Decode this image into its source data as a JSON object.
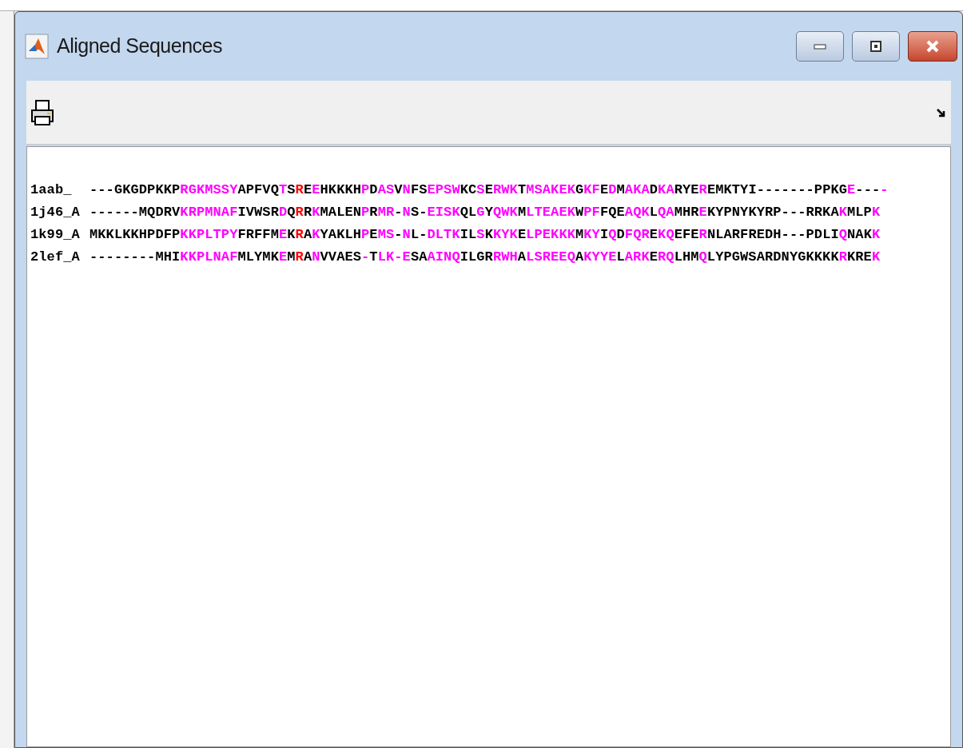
{
  "window": {
    "title": "Aligned Sequences"
  },
  "alignment": [
    {
      "name": "1aab_",
      "segments": [
        {
          "text": "---GKGDPKKP",
          "color": "#000000"
        },
        {
          "text": "RGKMSSY",
          "color": "#ff00ff"
        },
        {
          "text": "APFVQ",
          "color": "#000000"
        },
        {
          "text": "T",
          "color": "#ff00ff"
        },
        {
          "text": "S",
          "color": "#000000"
        },
        {
          "text": "R",
          "color": "#ff0000"
        },
        {
          "text": "E",
          "color": "#000000"
        },
        {
          "text": "E",
          "color": "#ff00ff"
        },
        {
          "text": "HKKKH",
          "color": "#000000"
        },
        {
          "text": "P",
          "color": "#ff00ff"
        },
        {
          "text": "D",
          "color": "#000000"
        },
        {
          "text": "AS",
          "color": "#ff00ff"
        },
        {
          "text": "V",
          "color": "#000000"
        },
        {
          "text": "N",
          "color": "#ff00ff"
        },
        {
          "text": "FS",
          "color": "#000000"
        },
        {
          "text": "EPSW",
          "color": "#ff00ff"
        },
        {
          "text": "KC",
          "color": "#000000"
        },
        {
          "text": "S",
          "color": "#ff00ff"
        },
        {
          "text": "E",
          "color": "#000000"
        },
        {
          "text": "RWK",
          "color": "#ff00ff"
        },
        {
          "text": "T",
          "color": "#000000"
        },
        {
          "text": "MSAKEK",
          "color": "#ff00ff"
        },
        {
          "text": "G",
          "color": "#000000"
        },
        {
          "text": "KF",
          "color": "#ff00ff"
        },
        {
          "text": "E",
          "color": "#000000"
        },
        {
          "text": "D",
          "color": "#ff00ff"
        },
        {
          "text": "M",
          "color": "#000000"
        },
        {
          "text": "AKA",
          "color": "#ff00ff"
        },
        {
          "text": "D",
          "color": "#000000"
        },
        {
          "text": "KA",
          "color": "#ff00ff"
        },
        {
          "text": "RYE",
          "color": "#000000"
        },
        {
          "text": "R",
          "color": "#ff00ff"
        },
        {
          "text": "EMKTYI-------PPKG",
          "color": "#000000"
        },
        {
          "text": "E",
          "color": "#ff00ff"
        },
        {
          "text": "---",
          "color": "#000000"
        },
        {
          "text": "-",
          "color": "#ff00ff"
        }
      ]
    },
    {
      "name": "1j46_A",
      "segments": [
        {
          "text": "------MQDRV",
          "color": "#000000"
        },
        {
          "text": "KRPMNAF",
          "color": "#ff00ff"
        },
        {
          "text": "IVWSR",
          "color": "#000000"
        },
        {
          "text": "D",
          "color": "#ff00ff"
        },
        {
          "text": "Q",
          "color": "#000000"
        },
        {
          "text": "R",
          "color": "#ff0000"
        },
        {
          "text": "R",
          "color": "#000000"
        },
        {
          "text": "K",
          "color": "#ff00ff"
        },
        {
          "text": "MALEN",
          "color": "#000000"
        },
        {
          "text": "P",
          "color": "#ff00ff"
        },
        {
          "text": "R",
          "color": "#000000"
        },
        {
          "text": "MR",
          "color": "#ff00ff"
        },
        {
          "text": "-",
          "color": "#000000"
        },
        {
          "text": "N",
          "color": "#ff00ff"
        },
        {
          "text": "S-",
          "color": "#000000"
        },
        {
          "text": "EISK",
          "color": "#ff00ff"
        },
        {
          "text": "QL",
          "color": "#000000"
        },
        {
          "text": "G",
          "color": "#ff00ff"
        },
        {
          "text": "Y",
          "color": "#000000"
        },
        {
          "text": "QWK",
          "color": "#ff00ff"
        },
        {
          "text": "M",
          "color": "#000000"
        },
        {
          "text": "LTEAEK",
          "color": "#ff00ff"
        },
        {
          "text": "W",
          "color": "#000000"
        },
        {
          "text": "PF",
          "color": "#ff00ff"
        },
        {
          "text": "FQE",
          "color": "#000000"
        },
        {
          "text": "AQK",
          "color": "#ff00ff"
        },
        {
          "text": "L",
          "color": "#000000"
        },
        {
          "text": "QA",
          "color": "#ff00ff"
        },
        {
          "text": "MHR",
          "color": "#000000"
        },
        {
          "text": "E",
          "color": "#ff00ff"
        },
        {
          "text": "KYPNYKYRP---RRKA",
          "color": "#000000"
        },
        {
          "text": "K",
          "color": "#ff00ff"
        },
        {
          "text": "MLP",
          "color": "#000000"
        },
        {
          "text": "K",
          "color": "#ff00ff"
        }
      ]
    },
    {
      "name": "1k99_A",
      "segments": [
        {
          "text": "MKKLKKHPDFP",
          "color": "#000000"
        },
        {
          "text": "KKPLTPY",
          "color": "#ff00ff"
        },
        {
          "text": "FRFFM",
          "color": "#000000"
        },
        {
          "text": "E",
          "color": "#ff00ff"
        },
        {
          "text": "K",
          "color": "#000000"
        },
        {
          "text": "R",
          "color": "#ff0000"
        },
        {
          "text": "A",
          "color": "#000000"
        },
        {
          "text": "K",
          "color": "#ff00ff"
        },
        {
          "text": "YAKLH",
          "color": "#000000"
        },
        {
          "text": "P",
          "color": "#ff00ff"
        },
        {
          "text": "E",
          "color": "#000000"
        },
        {
          "text": "MS",
          "color": "#ff00ff"
        },
        {
          "text": "-",
          "color": "#000000"
        },
        {
          "text": "N",
          "color": "#ff00ff"
        },
        {
          "text": "L-",
          "color": "#000000"
        },
        {
          "text": "DLTK",
          "color": "#ff00ff"
        },
        {
          "text": "IL",
          "color": "#000000"
        },
        {
          "text": "S",
          "color": "#ff00ff"
        },
        {
          "text": "K",
          "color": "#000000"
        },
        {
          "text": "KYK",
          "color": "#ff00ff"
        },
        {
          "text": "E",
          "color": "#000000"
        },
        {
          "text": "LPEKKK",
          "color": "#ff00ff"
        },
        {
          "text": "M",
          "color": "#000000"
        },
        {
          "text": "KY",
          "color": "#ff00ff"
        },
        {
          "text": "I",
          "color": "#000000"
        },
        {
          "text": "Q",
          "color": "#ff00ff"
        },
        {
          "text": "D",
          "color": "#000000"
        },
        {
          "text": "FQR",
          "color": "#ff00ff"
        },
        {
          "text": "E",
          "color": "#000000"
        },
        {
          "text": "KQ",
          "color": "#ff00ff"
        },
        {
          "text": "EFE",
          "color": "#000000"
        },
        {
          "text": "R",
          "color": "#ff00ff"
        },
        {
          "text": "NLARFREDH---PDLI",
          "color": "#000000"
        },
        {
          "text": "Q",
          "color": "#ff00ff"
        },
        {
          "text": "NAK",
          "color": "#000000"
        },
        {
          "text": "K",
          "color": "#ff00ff"
        }
      ]
    },
    {
      "name": "2lef_A",
      "segments": [
        {
          "text": "--------MHI",
          "color": "#000000"
        },
        {
          "text": "KKPLNAF",
          "color": "#ff00ff"
        },
        {
          "text": "MLYMK",
          "color": "#000000"
        },
        {
          "text": "E",
          "color": "#ff00ff"
        },
        {
          "text": "M",
          "color": "#000000"
        },
        {
          "text": "R",
          "color": "#ff0000"
        },
        {
          "text": "A",
          "color": "#000000"
        },
        {
          "text": "N",
          "color": "#ff00ff"
        },
        {
          "text": "VVAES",
          "color": "#000000"
        },
        {
          "text": "-",
          "color": "#ff00ff"
        },
        {
          "text": "T",
          "color": "#000000"
        },
        {
          "text": "LK-",
          "color": "#ff00ff"
        },
        {
          "text": "E",
          "color": "#ff00ff"
        },
        {
          "text": "SA",
          "color": "#000000"
        },
        {
          "text": "AINQ",
          "color": "#ff00ff"
        },
        {
          "text": "ILGR",
          "color": "#000000"
        },
        {
          "text": "RWH",
          "color": "#ff00ff"
        },
        {
          "text": "A",
          "color": "#000000"
        },
        {
          "text": "LSREEQ",
          "color": "#ff00ff"
        },
        {
          "text": "A",
          "color": "#000000"
        },
        {
          "text": "KYYE",
          "color": "#ff00ff"
        },
        {
          "text": "L",
          "color": "#000000"
        },
        {
          "text": "ARK",
          "color": "#ff00ff"
        },
        {
          "text": "E",
          "color": "#000000"
        },
        {
          "text": "RQ",
          "color": "#ff00ff"
        },
        {
          "text": "LHM",
          "color": "#000000"
        },
        {
          "text": "Q",
          "color": "#ff00ff"
        },
        {
          "text": "LYPGWSARDNYGKKKK",
          "color": "#000000"
        },
        {
          "text": "R",
          "color": "#ff00ff"
        },
        {
          "text": "KRE",
          "color": "#000000"
        },
        {
          "text": "K",
          "color": "#ff00ff"
        }
      ]
    }
  ]
}
